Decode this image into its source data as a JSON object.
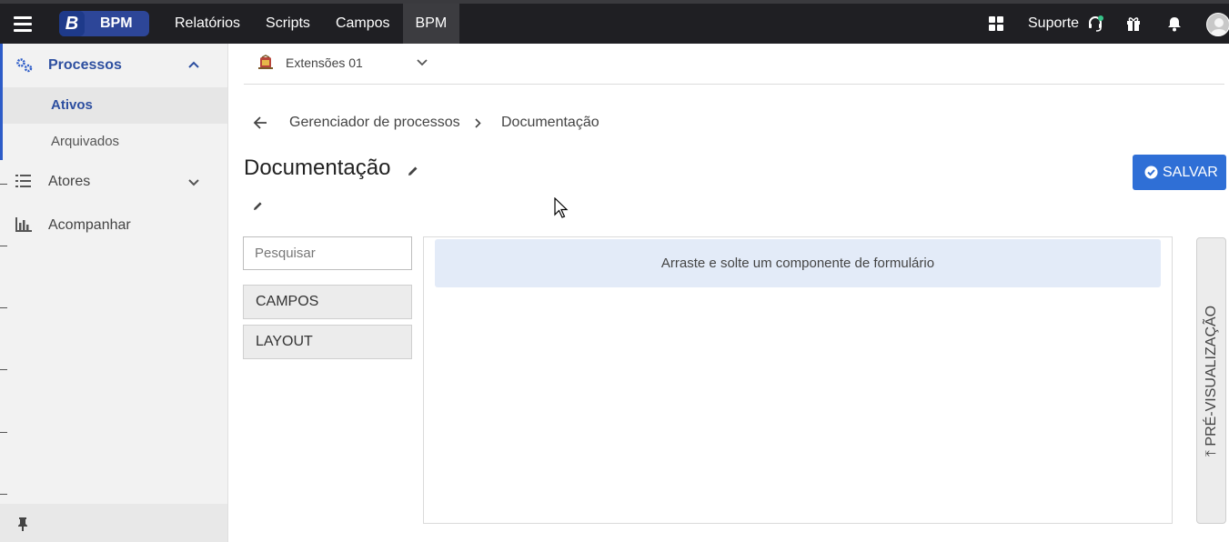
{
  "topbar": {
    "logo_text": "BPM",
    "nav": [
      "Relatórios",
      "Scripts",
      "Campos",
      "BPM"
    ],
    "active_nav": "BPM",
    "suporte_label": "Suporte"
  },
  "sidebar": {
    "processos": {
      "label": "Processos",
      "expanded": true,
      "items": [
        {
          "label": "Ativos",
          "active": true
        },
        {
          "label": "Arquivados",
          "active": false
        }
      ]
    },
    "atores_label": "Atores",
    "acompanhar_label": "Acompanhar"
  },
  "selector": {
    "value": "Extensões 01"
  },
  "breadcrumb": {
    "items": [
      "Gerenciador de processos",
      "Documentação"
    ]
  },
  "page": {
    "title": "Documentação",
    "save_label": "SALVAR"
  },
  "components": {
    "search_placeholder": "Pesquisar",
    "groups": [
      "CAMPOS",
      "LAYOUT"
    ]
  },
  "canvas": {
    "drop_hint": "Arraste e solte um componente de formulário"
  },
  "preview": {
    "label": "PRÉ-VISUALIZAÇÃO"
  },
  "colors": {
    "topbar_bg": "#1f1f23",
    "accent": "#2f6fd6",
    "logo_bg": "#2d4698",
    "drop_zone_bg": "#e3ebf8"
  }
}
